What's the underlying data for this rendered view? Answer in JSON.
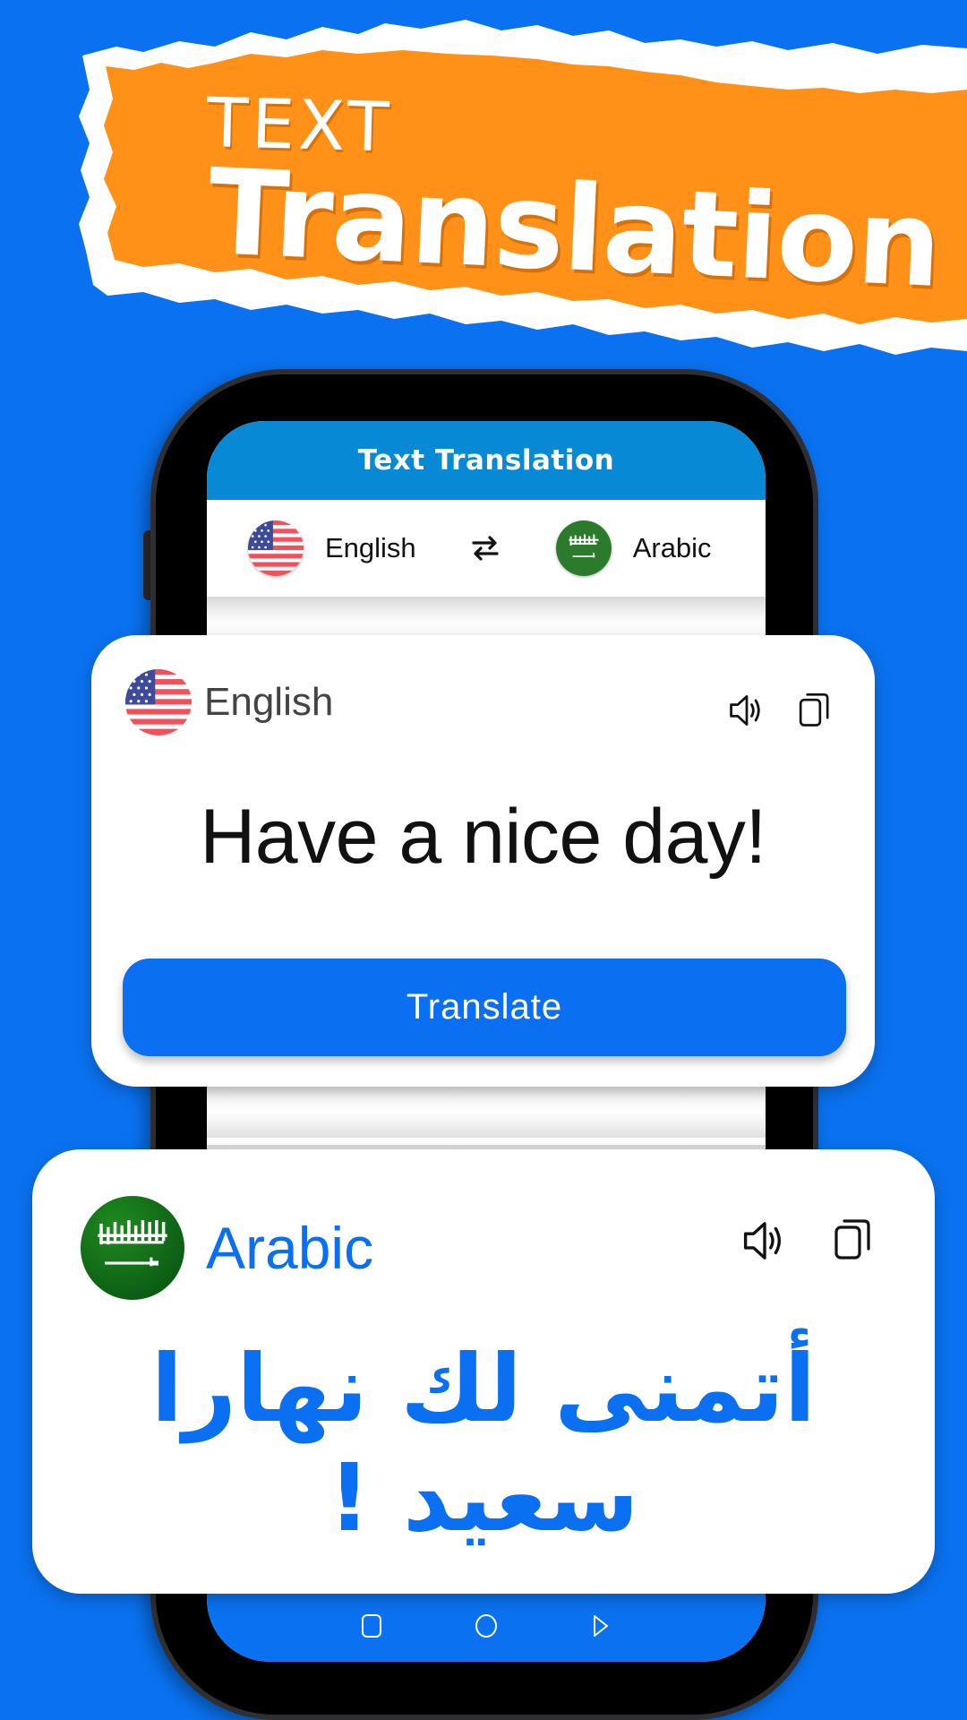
{
  "banner": {
    "line1": "TEXT",
    "line2": "Translation",
    "colors": {
      "paper": "#ff9119",
      "edge": "#ffffff",
      "background": "#0a72f0"
    }
  },
  "app": {
    "title": "Text Translation",
    "source_language": "English",
    "target_language": "Arabic",
    "swap_icon": "swap-arrows-icon"
  },
  "source_card": {
    "language": "English",
    "flag": "us-flag",
    "text": "Have a nice day!",
    "speaker_icon": "speaker-icon",
    "copy_icon": "copy-icon",
    "translate_label": "Translate"
  },
  "target_card": {
    "language": "Arabic",
    "flag": "saudi-arabia-flag",
    "text": "أتمنى لك نهارا سعيد !",
    "speaker_icon": "speaker-icon",
    "copy_icon": "copy-icon"
  },
  "nav_bar": {
    "buttons": [
      "recents",
      "home",
      "back"
    ]
  },
  "colors": {
    "accent": "#0a6ff0",
    "app_bar": "#0889d6",
    "banner_orange": "#ff9119"
  }
}
